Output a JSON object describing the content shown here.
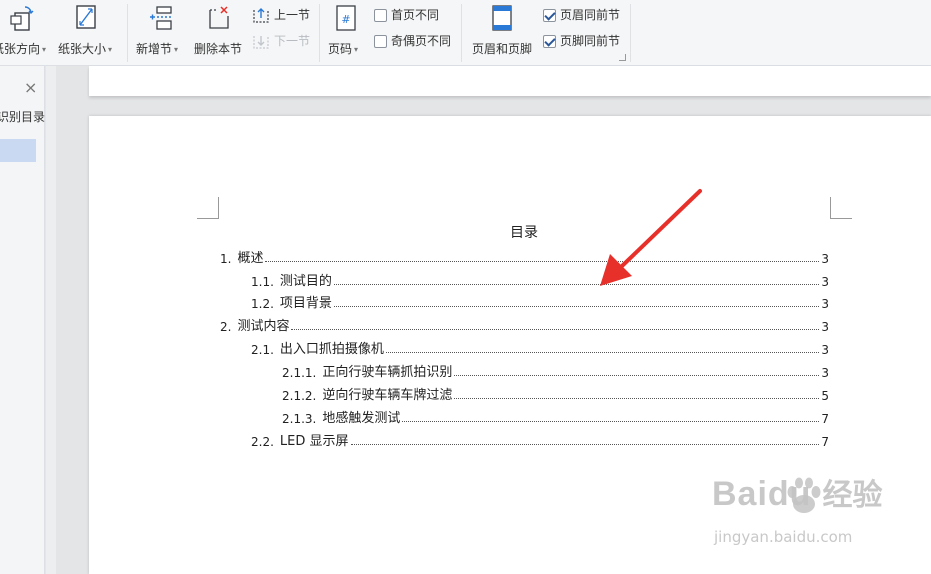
{
  "ribbon": {
    "paper_orientation": "纸张方向",
    "paper_size": "纸张大小",
    "new_section": "新增节",
    "delete_section": "删除本节",
    "prev_section": "上一节",
    "next_section": "下一节",
    "page_number": "页码",
    "first_page_different": "首页不同",
    "odd_even_different": "奇偶页不同",
    "header_footer": "页眉和页脚",
    "header_same_as_prev": "页眉同前节",
    "footer_same_as_prev": "页脚同前节",
    "first_page_checked": false,
    "odd_even_checked": false,
    "header_same_checked": true,
    "footer_same_checked": true
  },
  "nav": {
    "close": "×",
    "title": "识别目录"
  },
  "document": {
    "toc_title": "目录",
    "toc": [
      {
        "num": "1.",
        "text": "概述",
        "page": "3"
      },
      {
        "num": "1.1.",
        "text": "测试目的",
        "page": "3"
      },
      {
        "num": "1.2.",
        "text": "项目背景",
        "page": "3"
      },
      {
        "num": "2.",
        "text": "测试内容",
        "page": "3"
      },
      {
        "num": "2.1.",
        "text": "出入口抓拍摄像机",
        "page": "3"
      },
      {
        "num": "2.1.1.",
        "text": "正向行驶车辆抓拍识别",
        "page": "3"
      },
      {
        "num": "2.1.2.",
        "text": "逆向行驶车辆车牌过滤",
        "page": "5"
      },
      {
        "num": "2.1.3.",
        "text": "地感触发测试",
        "page": "7"
      },
      {
        "num": "2.2.",
        "text": "LED 显示屏",
        "page": "7"
      }
    ]
  },
  "watermark": {
    "brand": "Baidu",
    "brand_cn": "经验",
    "url": "jingyan.baidu.com"
  },
  "colors": {
    "accent": "#2b579a",
    "annotation_arrow": "#e8302a",
    "nav_selection": "#c9d9f1"
  }
}
